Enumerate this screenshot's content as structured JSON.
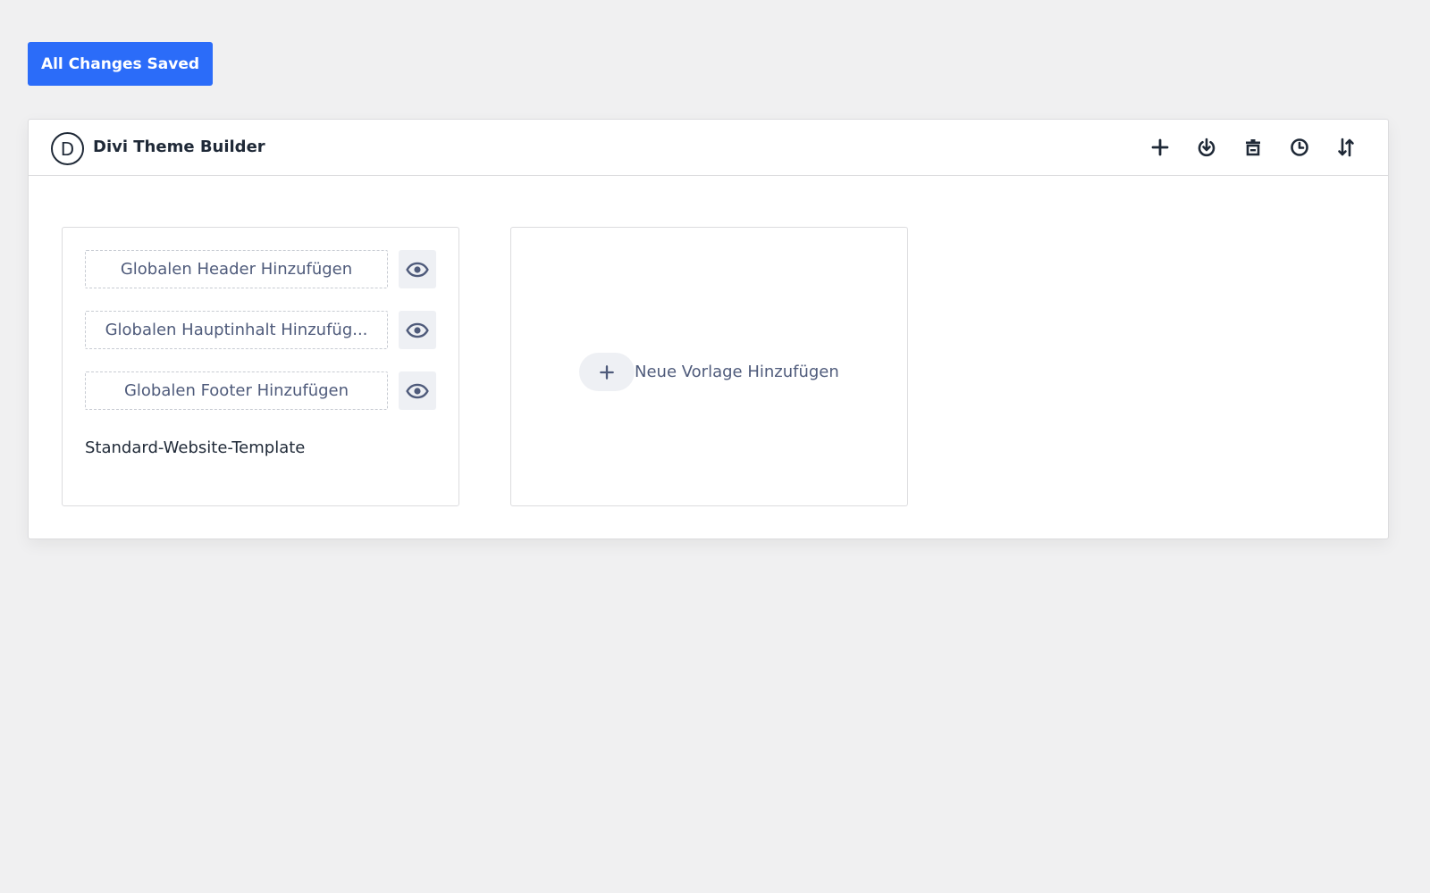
{
  "status_button": {
    "label": "All Changes Saved"
  },
  "header": {
    "logo_letter": "D",
    "title": "Divi Theme Builder",
    "toolbar_icons": [
      "plus-icon",
      "power-download-icon",
      "trash-icon",
      "history-icon",
      "sort-icon"
    ]
  },
  "default_template": {
    "slots": [
      {
        "label": "Globalen Header Hinzufügen"
      },
      {
        "label": "Globalen Hauptinhalt Hinzufüg..."
      },
      {
        "label": "Globalen Footer Hinzufügen"
      }
    ],
    "name": "Standard-Website-Template"
  },
  "new_template": {
    "label": "Neue Vorlage Hinzufügen"
  },
  "colors": {
    "accent": "#2b6cf9",
    "text_dark": "#1f2937",
    "text_muted": "#4f5b7b",
    "background": "#f0f0f1"
  }
}
